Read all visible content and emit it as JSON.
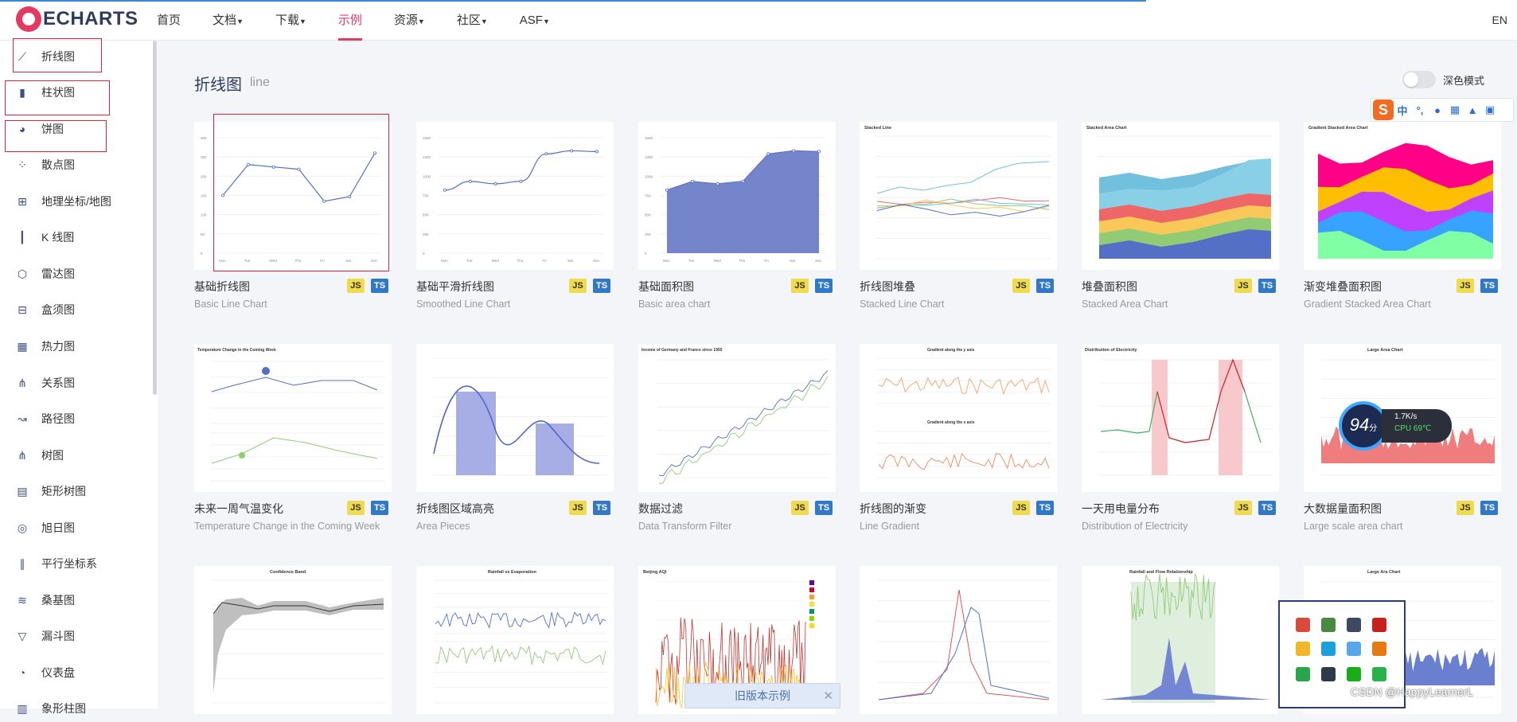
{
  "brand": {
    "logo_text": "ECHARTS"
  },
  "nav": {
    "items": [
      {
        "label": "首页",
        "dropdown": false
      },
      {
        "label": "文档",
        "dropdown": true
      },
      {
        "label": "下载",
        "dropdown": true
      },
      {
        "label": "示例",
        "dropdown": false,
        "active": true
      },
      {
        "label": "资源",
        "dropdown": true
      },
      {
        "label": "社区",
        "dropdown": true
      },
      {
        "label": "ASF",
        "dropdown": true
      }
    ],
    "lang": "EN"
  },
  "sidebar": {
    "items": [
      {
        "label": "折线图",
        "icon": "line-chart-icon",
        "highlighted": true
      },
      {
        "label": "柱状图",
        "icon": "bar-chart-icon",
        "highlighted": true
      },
      {
        "label": "饼图",
        "icon": "pie-chart-icon",
        "highlighted": true
      },
      {
        "label": "散点图",
        "icon": "scatter-chart-icon"
      },
      {
        "label": "地理坐标/地图",
        "icon": "map-icon"
      },
      {
        "label": "K 线图",
        "icon": "candlestick-icon"
      },
      {
        "label": "雷达图",
        "icon": "radar-chart-icon"
      },
      {
        "label": "盒须图",
        "icon": "boxplot-icon"
      },
      {
        "label": "热力图",
        "icon": "heatmap-icon"
      },
      {
        "label": "关系图",
        "icon": "graph-icon"
      },
      {
        "label": "路径图",
        "icon": "lines-icon"
      },
      {
        "label": "树图",
        "icon": "tree-icon"
      },
      {
        "label": "矩形树图",
        "icon": "treemap-icon"
      },
      {
        "label": "旭日图",
        "icon": "sunburst-icon"
      },
      {
        "label": "平行坐标系",
        "icon": "parallel-icon"
      },
      {
        "label": "桑基图",
        "icon": "sankey-icon"
      },
      {
        "label": "漏斗图",
        "icon": "funnel-icon"
      },
      {
        "label": "仪表盘",
        "icon": "gauge-icon"
      },
      {
        "label": "象形柱图",
        "icon": "pictorial-bar-icon"
      }
    ]
  },
  "section": {
    "title": "折线图",
    "subtitle": "line"
  },
  "dark_mode": {
    "label": "深色模式",
    "enabled": false
  },
  "badges": {
    "js": "JS",
    "ts": "TS"
  },
  "cards": [
    {
      "name": "基础折线图",
      "en": "Basic Line Chart",
      "kind": "line",
      "highlighted": true
    },
    {
      "name": "基础平滑折线图",
      "en": "Smoothed Line Chart",
      "kind": "smooth"
    },
    {
      "name": "基础面积图",
      "en": "Basic area chart",
      "kind": "area"
    },
    {
      "name": "折线图堆叠",
      "en": "Stacked Line Chart",
      "kind": "stacked-line"
    },
    {
      "name": "堆叠面积图",
      "en": "Stacked Area Chart",
      "kind": "stacked-area"
    },
    {
      "name": "渐变堆叠面积图",
      "en": "Gradient Stacked Area Chart",
      "kind": "gradient-stacked"
    },
    {
      "name": "未来一周气温变化",
      "en": "Temperature Change in the Coming Week",
      "kind": "temperature"
    },
    {
      "name": "折线图区域高亮",
      "en": "Area Pieces",
      "kind": "area-pieces"
    },
    {
      "name": "数据过滤",
      "en": "Data Transform Filter",
      "kind": "filter"
    },
    {
      "name": "折线图的渐变",
      "en": "Line Gradient",
      "kind": "gradient"
    },
    {
      "name": "一天用电量分布",
      "en": "Distribution of Electricity",
      "kind": "electricity"
    },
    {
      "name": "大数据量面积图",
      "en": "Large scale area chart",
      "kind": "large-area"
    },
    {
      "name": "",
      "en": "",
      "kind": "confidence"
    },
    {
      "name": "",
      "en": "",
      "kind": "rainfall"
    },
    {
      "name": "",
      "en": "",
      "kind": "aqi"
    },
    {
      "name": "",
      "en": "",
      "kind": "precipitation"
    },
    {
      "name": "",
      "en": "",
      "kind": "flow"
    },
    {
      "name": "",
      "en": "",
      "kind": "large-area-2"
    }
  ],
  "thumbnail_titles": {
    "stacked_line": "Stacked Line",
    "stacked_area": "Stacked Area Chart",
    "gradient_stacked": "Gradient Stacked Area Chart",
    "temperature": "Temperature Change in the Coming Week",
    "filter": "Income of Germany and France since 1950",
    "gradient_y": "Gradient along the y axis",
    "gradient_x": "Gradient along the x axis",
    "electricity": "Distribution of Electricity",
    "large_area": "Large Area Chart",
    "confidence": "Confidence Band",
    "rainfall": "Rainfall vs Evaporation",
    "aqi": "Beijing AQI",
    "flow": "Rainfall and Flow Relationship",
    "large_area_2": "Large Ara Chart"
  },
  "chart_data": [
    {
      "type": "line",
      "categories": [
        "Mon",
        "Tue",
        "Wed",
        "Thu",
        "Fri",
        "Sat",
        "Sun"
      ],
      "values": [
        150,
        230,
        224,
        218,
        135,
        147,
        260
      ],
      "ylim": [
        0,
        300
      ]
    },
    {
      "type": "line",
      "categories": [
        "Mon",
        "Tue",
        "Wed",
        "Thu",
        "Fri",
        "Sat",
        "Sun"
      ],
      "values": [
        820,
        932,
        901,
        934,
        1290,
        1330,
        1320
      ],
      "ylim": [
        0,
        1500
      ]
    },
    {
      "type": "area",
      "categories": [
        "Mon",
        "Tue",
        "Wed",
        "Thu",
        "Fri",
        "Sat",
        "Sun"
      ],
      "values": [
        820,
        932,
        901,
        934,
        1290,
        1330,
        1320
      ],
      "ylim": [
        0,
        1500
      ]
    }
  ],
  "widget_speed": {
    "score": "94",
    "unit": "分",
    "speed": "1.7K/s",
    "cpu": "CPU 69℃"
  },
  "old_version": {
    "label": "旧版本示例",
    "close": "✕"
  },
  "watermark": "CSDN @HappyLearnerL"
}
